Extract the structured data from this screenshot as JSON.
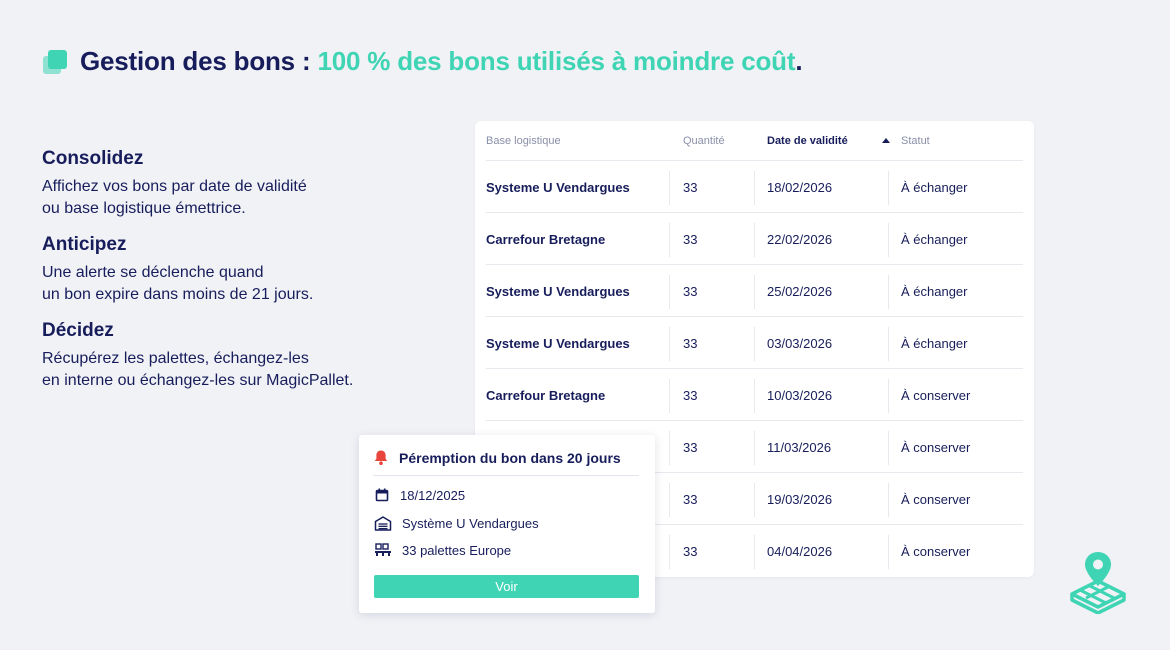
{
  "colors": {
    "navy": "#171d5b",
    "teal": "#3ed4b4",
    "red": "#e8453c",
    "background": "#f1f2f6"
  },
  "header": {
    "icon": "stacked-cards-icon",
    "title_navy": "Gestion des bons : ",
    "title_teal": "100 % des bons utilisés à moindre coût",
    "title_end": "."
  },
  "features": [
    {
      "title": "Consolidez",
      "line1": "Affichez vos bons par date de validité",
      "line2": "ou base logistique émettrice."
    },
    {
      "title": "Anticipez",
      "line1": "Une alerte se déclenche quand",
      "line2": "un bon expire dans moins de 21 jours."
    },
    {
      "title": "Décidez",
      "line1": "Récupérez les palettes, échangez-les",
      "line2": "en interne ou échangez-les sur MagicPallet."
    }
  ],
  "table": {
    "columns": [
      "Base logistique",
      "Quantité",
      "Date de validité",
      "Statut"
    ],
    "sorted_column": "Date de validité",
    "sort_direction": "ascending",
    "rows": [
      {
        "base": "Systeme U Vendargues",
        "qty": "33",
        "date": "18/02/2026",
        "status": "À échanger"
      },
      {
        "base": "Carrefour Bretagne",
        "qty": "33",
        "date": "22/02/2026",
        "status": "À échanger"
      },
      {
        "base": "Systeme U Vendargues",
        "qty": "33",
        "date": "25/02/2026",
        "status": "À échanger"
      },
      {
        "base": "Systeme U Vendargues",
        "qty": "33",
        "date": "03/03/2026",
        "status": "À échanger"
      },
      {
        "base": "Carrefour Bretagne",
        "qty": "33",
        "date": "10/03/2026",
        "status": "À conserver"
      },
      {
        "base": "",
        "qty": "33",
        "date": "11/03/2026",
        "status": "À conserver"
      },
      {
        "base": "",
        "qty": "33",
        "date": "19/03/2026",
        "status": "À conserver"
      },
      {
        "base": "",
        "qty": "33",
        "date": "04/04/2026",
        "status": "À conserver"
      }
    ]
  },
  "alert": {
    "icon": "bell-icon",
    "title": "Péremption du bon dans 20 jours",
    "date_icon": "calendar-icon",
    "date": "18/12/2025",
    "base_icon": "warehouse-icon",
    "base": "Système U Vendargues",
    "pallets_icon": "pallets-icon",
    "pallets": "33 palettes Europe",
    "button": "Voir"
  },
  "brand": {
    "icon": "magicpallet-logo-icon"
  }
}
